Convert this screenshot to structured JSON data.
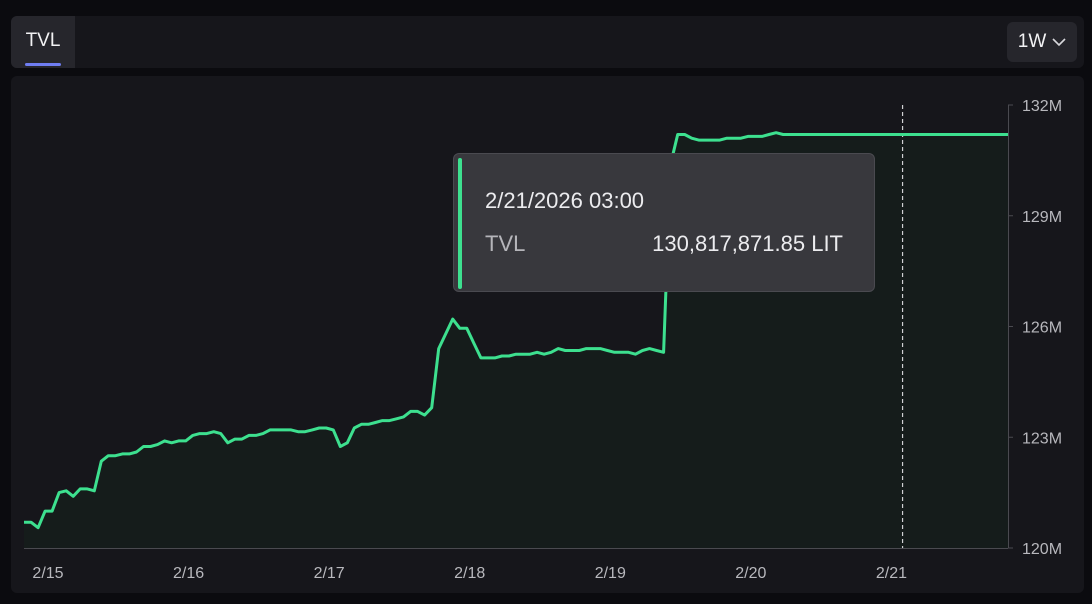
{
  "header": {
    "tab_label": "TVL",
    "range_label": "1W"
  },
  "tooltip": {
    "date": "2/21/2026 03:00",
    "key": "TVL",
    "value": "130,817,871.85 LIT"
  },
  "colors": {
    "line": "#3de08f",
    "tab_underline": "#6f7df2",
    "background": "#16161b"
  },
  "chart_data": {
    "type": "area",
    "series": [
      {
        "x": [
          0.0,
          0.05,
          0.1,
          0.15,
          0.2,
          0.25,
          0.3,
          0.35,
          0.4,
          0.45,
          0.5,
          0.55,
          0.6,
          0.65,
          0.7,
          0.75,
          0.8,
          0.85,
          0.9,
          0.95,
          1.0,
          1.05,
          1.1,
          1.15,
          1.2,
          1.25,
          1.3,
          1.35,
          1.4,
          1.45,
          1.5,
          1.55,
          1.6,
          1.65,
          1.7,
          1.75,
          1.8,
          1.85,
          1.9,
          1.95,
          2.0,
          2.05,
          2.1,
          2.15,
          2.2,
          2.25,
          2.3,
          2.35,
          2.4,
          2.45,
          2.5,
          2.55,
          2.6,
          2.65,
          2.7,
          2.75,
          2.8,
          2.85,
          2.9,
          2.95,
          3.0,
          3.05,
          3.1,
          3.15,
          3.2,
          3.25,
          3.3,
          3.35,
          3.4,
          3.45,
          3.5,
          3.55,
          3.6,
          3.65,
          3.7,
          3.75,
          3.8,
          3.85,
          3.9,
          3.95,
          4.0,
          4.05,
          4.1,
          4.15,
          4.2,
          4.25,
          4.3,
          4.35,
          4.4,
          4.45,
          4.5,
          4.55,
          4.6,
          4.65,
          4.7,
          4.75,
          4.8,
          4.85,
          4.9,
          4.95,
          5.0,
          5.05,
          5.1,
          5.15,
          5.2,
          5.25,
          5.3,
          5.35,
          5.4,
          5.45,
          5.5,
          5.55,
          5.6,
          5.65,
          5.7,
          5.75,
          5.8,
          5.85,
          5.9,
          5.95,
          6.0,
          6.05,
          6.1,
          6.15,
          6.2,
          6.25,
          6.3,
          6.35,
          6.4,
          6.45,
          6.5,
          6.55,
          6.6,
          6.65,
          6.7,
          6.75,
          6.8,
          6.85,
          6.9,
          6.95,
          7.0
        ],
        "y": [
          120.7,
          120.7,
          120.55,
          121.0,
          121.0,
          121.5,
          121.55,
          121.4,
          121.6,
          121.6,
          121.55,
          122.35,
          122.5,
          122.5,
          122.55,
          122.55,
          122.6,
          122.75,
          122.75,
          122.8,
          122.9,
          122.85,
          122.9,
          122.9,
          123.05,
          123.1,
          123.1,
          123.15,
          123.1,
          122.85,
          122.95,
          122.95,
          123.05,
          123.05,
          123.1,
          123.2,
          123.2,
          123.2,
          123.2,
          123.15,
          123.15,
          123.2,
          123.25,
          123.25,
          123.2,
          122.75,
          122.85,
          123.25,
          123.35,
          123.35,
          123.4,
          123.45,
          123.45,
          123.5,
          123.55,
          123.7,
          123.7,
          123.6,
          123.8,
          125.4,
          125.8,
          126.2,
          125.95,
          125.95,
          125.55,
          125.15,
          125.15,
          125.15,
          125.2,
          125.2,
          125.25,
          125.25,
          125.25,
          125.3,
          125.25,
          125.3,
          125.4,
          125.35,
          125.35,
          125.35,
          125.4,
          125.4,
          125.4,
          125.35,
          125.3,
          125.3,
          125.3,
          125.25,
          125.35,
          125.4,
          125.35,
          125.3,
          130.4,
          131.2,
          131.2,
          131.1,
          131.05,
          131.05,
          131.05,
          131.05,
          131.1,
          131.1,
          131.1,
          131.15,
          131.15,
          131.15,
          131.2,
          131.25,
          131.2,
          131.2,
          131.2,
          131.2,
          131.2,
          131.2,
          131.2,
          131.2,
          131.2,
          131.2,
          131.2,
          131.2,
          131.2,
          131.2,
          131.2,
          131.2,
          131.2,
          131.2,
          131.2,
          131.2,
          131.2,
          131.2,
          131.2,
          131.2,
          131.2,
          131.2,
          131.2,
          131.2,
          131.2,
          131.2,
          131.2,
          131.2,
          131.2
        ]
      }
    ],
    "x_tick_labels": [
      "2/15",
      "2/16",
      "2/17",
      "2/18",
      "2/19",
      "2/20",
      "2/21"
    ],
    "y_tick_labels": [
      "120M",
      "123M",
      "126M",
      "129M",
      "132M"
    ],
    "y_ticks": [
      120,
      123,
      126,
      129,
      132
    ],
    "ylim": [
      120,
      132
    ],
    "xlim": [
      0,
      7
    ],
    "cursor_x": 6.25
  }
}
